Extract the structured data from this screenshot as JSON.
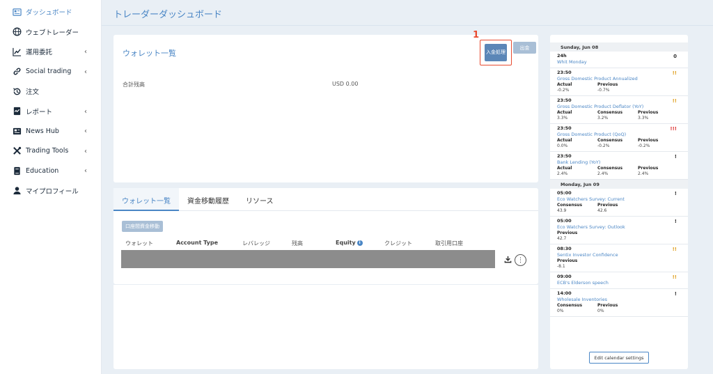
{
  "page": {
    "title": "トレーダーダッシュボード"
  },
  "sidebar": {
    "items": [
      {
        "label": "ダッシュボード",
        "icon": "dashboard-icon",
        "active": true,
        "chevron": false
      },
      {
        "label": "ウェブトレーダー",
        "icon": "globe-icon",
        "chevron": false
      },
      {
        "label": "運用委託",
        "icon": "chart-line-icon",
        "chevron": true
      },
      {
        "label": "Social trading",
        "icon": "link-icon",
        "chevron": true
      },
      {
        "label": "注文",
        "icon": "history-icon",
        "chevron": false
      },
      {
        "label": "レポート",
        "icon": "report-icon",
        "chevron": true
      },
      {
        "label": "News Hub",
        "icon": "newspaper-icon",
        "chevron": true
      },
      {
        "label": "Trading Tools",
        "icon": "tools-icon",
        "chevron": true
      },
      {
        "label": "Education",
        "icon": "book-icon",
        "chevron": true
      },
      {
        "label": "マイプロフィール",
        "icon": "user-icon",
        "chevron": false
      }
    ],
    "chevron_glyph": "‹"
  },
  "wallet": {
    "title": "ウォレット一覧",
    "deposit_label": "入金処理",
    "withdraw_label": "出金",
    "marker": "1",
    "total_label": "合計残高",
    "total_value": "USD 0.00"
  },
  "tabs": {
    "items": [
      "ウォレット一覧",
      "資金移動履歴",
      "リソース"
    ],
    "transfer_button": "口座間資金移動",
    "columns": [
      "ウォレット",
      "Account Type",
      "レバレッジ",
      "残高",
      "Equity",
      "クレジット",
      "取引用口座"
    ],
    "info_glyph": "i",
    "more_glyph": "⋮"
  },
  "calendar": {
    "days": [
      {
        "date": "Sunday, Jun 08",
        "events": [
          {
            "time": "24h",
            "name": "Whit Monday",
            "importance": "0",
            "level": 0,
            "cols": []
          },
          {
            "time": "23:50",
            "name": "Gross Domestic Product Annualized",
            "importance": "!!",
            "level": 2,
            "cols": [
              {
                "h": "Actual",
                "v": "-0.2%"
              },
              {
                "h": "Previous",
                "v": "-0.7%"
              }
            ]
          },
          {
            "time": "23:50",
            "name": "Gross Domestic Product Deflator (YoY)",
            "importance": "!!",
            "level": 2,
            "cols": [
              {
                "h": "Actual",
                "v": "3.3%"
              },
              {
                "h": "Consensus",
                "v": "3.2%"
              },
              {
                "h": "Previous",
                "v": "3.3%"
              }
            ]
          },
          {
            "time": "23:50",
            "name": "Gross Domestic Product (QoQ)",
            "importance": "!!!",
            "level": 3,
            "cols": [
              {
                "h": "Actual",
                "v": "0.0%"
              },
              {
                "h": "Consensus",
                "v": "-0.2%"
              },
              {
                "h": "Previous",
                "v": "-0.2%"
              }
            ]
          },
          {
            "time": "23:50",
            "name": "Bank Lending (YoY)",
            "importance": "!",
            "level": 1,
            "cols": [
              {
                "h": "Actual",
                "v": "2.4%"
              },
              {
                "h": "Consensus",
                "v": "2.4%"
              },
              {
                "h": "Previous",
                "v": "2.4%"
              }
            ]
          }
        ]
      },
      {
        "date": "Monday, Jun 09",
        "events": [
          {
            "time": "05:00",
            "name": "Eco Watchers Survey: Current",
            "importance": "!",
            "level": 1,
            "cols": [
              {
                "h": "Consensus",
                "v": "43.9"
              },
              {
                "h": "Previous",
                "v": "42.6"
              }
            ]
          },
          {
            "time": "05:00",
            "name": "Eco Watchers Survey: Outlook",
            "importance": "!",
            "level": 1,
            "cols": [
              {
                "h": "Previous",
                "v": "42.7"
              }
            ]
          },
          {
            "time": "08:30",
            "name": "Sentix Investor Confidence",
            "importance": "!!",
            "level": 2,
            "cols": [
              {
                "h": "Previous",
                "v": "-8.1"
              }
            ]
          },
          {
            "time": "09:00",
            "name": "ECB's Elderson speech",
            "importance": "!!",
            "level": 2,
            "cols": []
          },
          {
            "time": "14:00",
            "name": "Wholesale Inventories",
            "importance": "!",
            "level": 1,
            "cols": [
              {
                "h": "Consensus",
                "v": "0%"
              },
              {
                "h": "Previous",
                "v": "0%"
              }
            ]
          }
        ]
      }
    ],
    "edit_label": "Edit calendar settings"
  },
  "colors": {
    "accent": "#4a86c5",
    "highlight": "#e84a2f",
    "important": "#e0a020",
    "critical": "#d33333"
  }
}
